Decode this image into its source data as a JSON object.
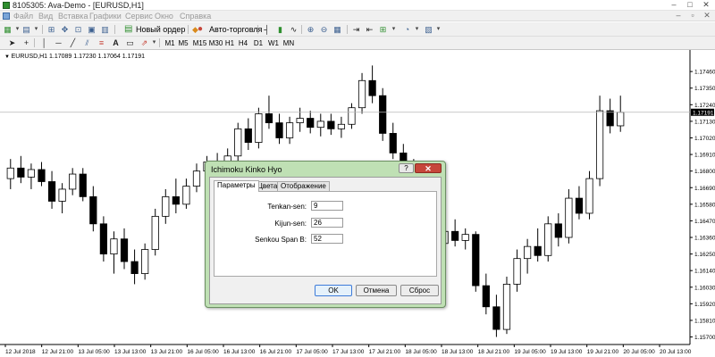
{
  "window": {
    "title": "8105305: Ava-Demo - [EURUSD,H1]",
    "controls": [
      "‒",
      "□",
      "✕"
    ]
  },
  "menu": {
    "items": [
      "Файл",
      "Вид",
      "Вставка",
      "Графики",
      "Сервис",
      "Окно",
      "Справка"
    ],
    "mdi_controls": [
      "‒",
      "▫",
      "✕"
    ]
  },
  "toolbar": {
    "new_order_label": "Новый ордер",
    "autotrading_label": "Авто-торговля"
  },
  "timeframes": [
    "M1",
    "M5",
    "M15",
    "M30",
    "H1",
    "H4",
    "D1",
    "W1",
    "MN"
  ],
  "chart": {
    "symbol_label": "EURUSD,H1  1.17089 1.17230 1.17064 1.17191",
    "current_price": "1.17191"
  },
  "dialog": {
    "title": "Ichimoku Kinko Hyo",
    "help": "?",
    "close": "✕",
    "tabs": [
      "Параметры",
      "Цвета",
      "Отображение"
    ],
    "fields": [
      {
        "label": "Tenkan-sen:",
        "value": "9"
      },
      {
        "label": "Kijun-sen:",
        "value": "26"
      },
      {
        "label": "Senkou Span B:",
        "value": "52"
      }
    ],
    "buttons": {
      "ok": "OK",
      "cancel": "Отмена",
      "reset": "Сброс"
    }
  },
  "colors": {
    "candle_bull": "#ffffff",
    "candle_bear": "#000000",
    "dialog_frame": "#bfe0b4",
    "close_button": "#c6463a"
  },
  "chart_data": {
    "type": "candlestick",
    "y_ticks": [
      "1.17460",
      "1.17350",
      "1.17240",
      "1.17130",
      "1.17020",
      "1.16910",
      "1.16800",
      "1.16690",
      "1.16580",
      "1.16470",
      "1.16360",
      "1.16250",
      "1.16140",
      "1.16030",
      "1.15920",
      "1.15810",
      "1.15700"
    ],
    "y_range": [
      1.1565,
      1.1752
    ],
    "x_labels": [
      "12 Jul 2018",
      "12 Jul 21:00",
      "13 Jul 05:00",
      "13 Jul 13:00",
      "13 Jul 21:00",
      "16 Jul 05:00",
      "16 Jul 13:00",
      "16 Jul 21:00",
      "17 Jul 05:00",
      "17 Jul 13:00",
      "17 Jul 21:00",
      "18 Jul 05:00",
      "18 Jul 13:00",
      "18 Jul 21:00",
      "19 Jul 05:00",
      "19 Jul 13:00",
      "19 Jul 21:00",
      "20 Jul 05:00",
      "20 Jul 13:00"
    ],
    "candles": [
      [
        1.1675,
        1.1688,
        1.1668,
        1.1682
      ],
      [
        1.1682,
        1.169,
        1.1672,
        1.1676
      ],
      [
        1.1676,
        1.1685,
        1.1668,
        1.1681
      ],
      [
        1.1681,
        1.1686,
        1.167,
        1.1673
      ],
      [
        1.1673,
        1.168,
        1.1655,
        1.166
      ],
      [
        1.166,
        1.1672,
        1.1652,
        1.1668
      ],
      [
        1.1668,
        1.1682,
        1.1664,
        1.1678
      ],
      [
        1.1678,
        1.1682,
        1.166,
        1.1663
      ],
      [
        1.1663,
        1.167,
        1.164,
        1.1645
      ],
      [
        1.1645,
        1.165,
        1.162,
        1.1625
      ],
      [
        1.1625,
        1.164,
        1.1612,
        1.1635
      ],
      [
        1.1635,
        1.1642,
        1.1615,
        1.162
      ],
      [
        1.162,
        1.1628,
        1.1605,
        1.1612
      ],
      [
        1.1612,
        1.1632,
        1.1608,
        1.1628
      ],
      [
        1.1628,
        1.1655,
        1.1624,
        1.165
      ],
      [
        1.165,
        1.1668,
        1.1645,
        1.1663
      ],
      [
        1.1663,
        1.1675,
        1.1652,
        1.1658
      ],
      [
        1.1658,
        1.1675,
        1.1655,
        1.167
      ],
      [
        1.167,
        1.1685,
        1.1666,
        1.168
      ],
      [
        1.168,
        1.169,
        1.1672,
        1.1686
      ],
      [
        1.1686,
        1.1692,
        1.1675,
        1.1678
      ],
      [
        1.1678,
        1.1695,
        1.1674,
        1.169
      ],
      [
        1.169,
        1.1712,
        1.1686,
        1.1708
      ],
      [
        1.1708,
        1.1715,
        1.1694,
        1.1699
      ],
      [
        1.1699,
        1.1722,
        1.1695,
        1.1718
      ],
      [
        1.1718,
        1.173,
        1.1708,
        1.1712
      ],
      [
        1.1712,
        1.1718,
        1.1698,
        1.1702
      ],
      [
        1.1702,
        1.1716,
        1.1698,
        1.1712
      ],
      [
        1.1712,
        1.1722,
        1.1706,
        1.1715
      ],
      [
        1.1715,
        1.172,
        1.1705,
        1.1709
      ],
      [
        1.1709,
        1.1718,
        1.1703,
        1.1713
      ],
      [
        1.1713,
        1.1718,
        1.1704,
        1.1708
      ],
      [
        1.1708,
        1.1716,
        1.1702,
        1.1711
      ],
      [
        1.1711,
        1.1725,
        1.1708,
        1.1722
      ],
      [
        1.1722,
        1.1745,
        1.1718,
        1.174
      ],
      [
        1.174,
        1.175,
        1.1725,
        1.173
      ],
      [
        1.173,
        1.1735,
        1.17,
        1.1705
      ],
      [
        1.1705,
        1.1712,
        1.1688,
        1.1692
      ],
      [
        1.1692,
        1.1698,
        1.1675,
        1.168
      ],
      [
        1.168,
        1.1688,
        1.1668,
        1.1672
      ],
      [
        1.1645,
        1.1652,
        1.163,
        1.1635
      ],
      [
        1.1635,
        1.164,
        1.1625,
        1.1632
      ],
      [
        1.1632,
        1.1645,
        1.1628,
        1.164
      ],
      [
        1.164,
        1.1648,
        1.163,
        1.1634
      ],
      [
        1.1634,
        1.1642,
        1.1628,
        1.1638
      ],
      [
        1.1638,
        1.164,
        1.16,
        1.1604
      ],
      [
        1.1604,
        1.1612,
        1.1585,
        1.159
      ],
      [
        1.159,
        1.1598,
        1.157,
        1.1575
      ],
      [
        1.1575,
        1.161,
        1.1572,
        1.1605
      ],
      [
        1.1605,
        1.1628,
        1.16,
        1.1622
      ],
      [
        1.1622,
        1.1635,
        1.1612,
        1.163
      ],
      [
        1.163,
        1.1642,
        1.162,
        1.1624
      ],
      [
        1.1624,
        1.165,
        1.162,
        1.1645
      ],
      [
        1.1645,
        1.1652,
        1.163,
        1.1636
      ],
      [
        1.1636,
        1.1668,
        1.1632,
        1.1662
      ],
      [
        1.1662,
        1.167,
        1.1648,
        1.1652
      ],
      [
        1.1652,
        1.168,
        1.1648,
        1.1675
      ],
      [
        1.1675,
        1.173,
        1.167,
        1.172
      ],
      [
        1.172,
        1.1728,
        1.1705,
        1.171
      ],
      [
        1.171,
        1.173,
        1.1706,
        1.1719
      ]
    ]
  }
}
